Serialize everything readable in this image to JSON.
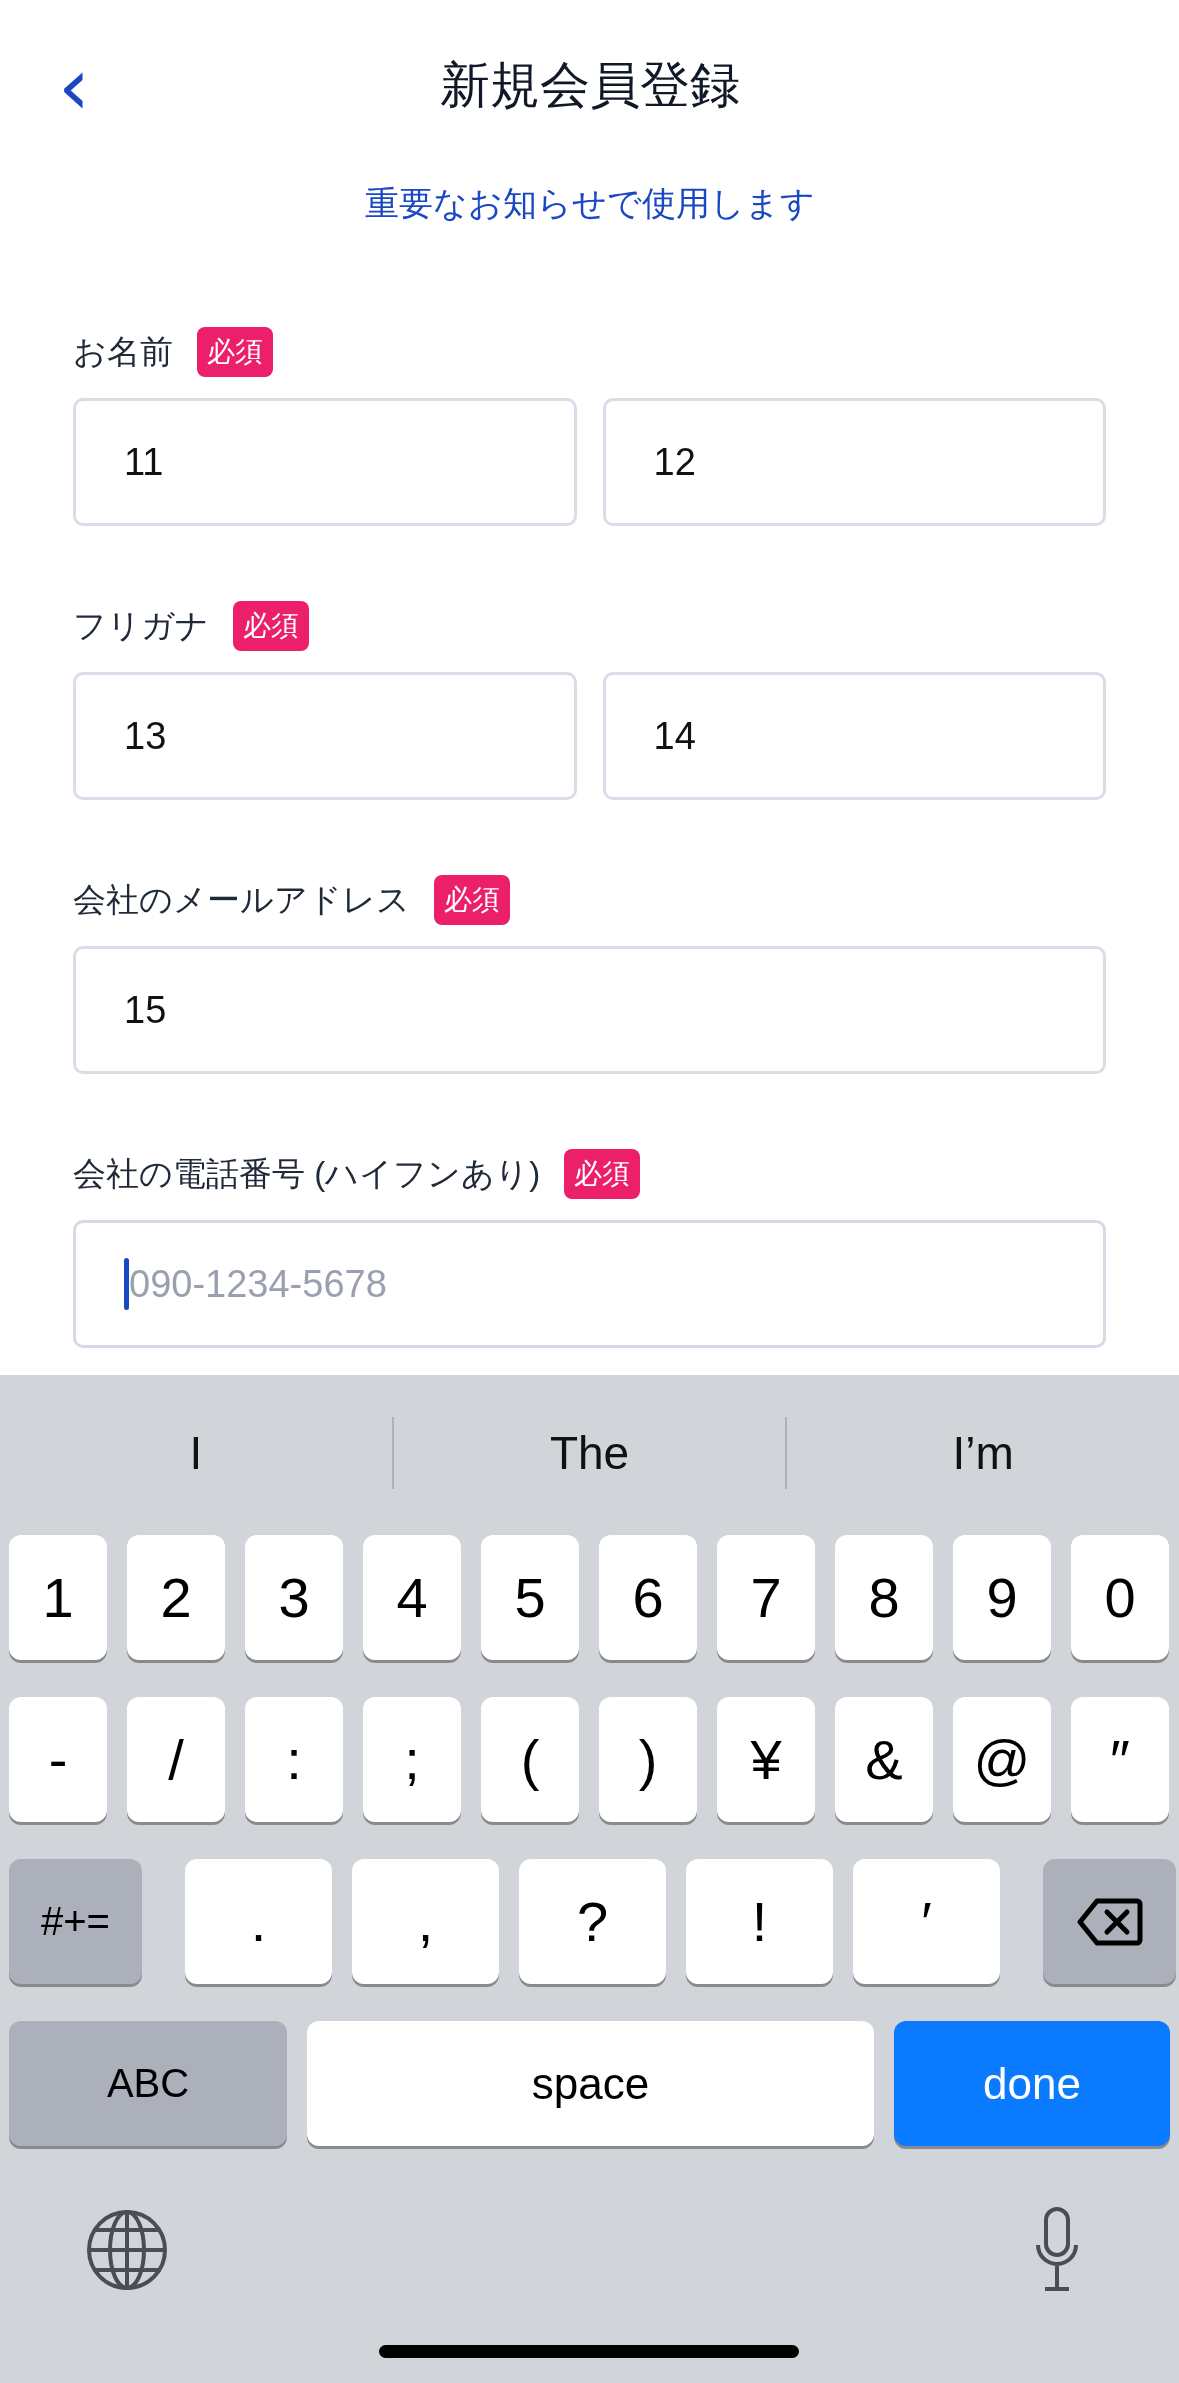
{
  "header": {
    "back": "‹",
    "title": "新規会員登録"
  },
  "notice": "重要なお知らせで使用します",
  "fields": [
    {
      "label": "お名前",
      "badge": "必須",
      "inputs": [
        {
          "value": "11",
          "focused": false
        },
        {
          "value": "12",
          "focused": false
        }
      ]
    },
    {
      "label": "フリガナ",
      "badge": "必須",
      "inputs": [
        {
          "value": "13",
          "focused": false
        },
        {
          "value": "14",
          "focused": false
        }
      ]
    },
    {
      "label": "会社のメールアドレス",
      "badge": "必須",
      "inputs": [
        {
          "value": "15",
          "focused": false
        }
      ]
    },
    {
      "label": "会社の電話番号 (ハイフンあり)",
      "badge": "必須",
      "inputs": [
        {
          "placeholder": "090-1234-5678",
          "focused": true
        }
      ]
    }
  ],
  "keyboard": {
    "suggestions": [
      "I",
      "The",
      "I’m"
    ],
    "number_keys": [
      {
        "kind": "char",
        "label": "1"
      },
      {
        "kind": "char",
        "label": "2"
      },
      {
        "kind": "char",
        "label": "3"
      },
      {
        "kind": "char",
        "label": "4"
      },
      {
        "kind": "char",
        "label": "5"
      },
      {
        "kind": "char",
        "label": "6"
      },
      {
        "kind": "char",
        "label": "7"
      },
      {
        "kind": "char",
        "label": "8"
      },
      {
        "kind": "char",
        "label": "9"
      },
      {
        "kind": "char",
        "label": "0"
      }
    ],
    "symbol_keys": [
      {
        "kind": "char",
        "label": "-"
      },
      {
        "kind": "char",
        "label": "/"
      },
      {
        "kind": "char",
        "label": ":"
      },
      {
        "kind": "char",
        "label": ";"
      },
      {
        "kind": "char",
        "label": "("
      },
      {
        "kind": "char",
        "label": ")"
      },
      {
        "kind": "char",
        "label": "¥"
      },
      {
        "kind": "char",
        "label": "&"
      },
      {
        "kind": "char",
        "label": "@"
      },
      {
        "kind": "char",
        "label": "″"
      }
    ],
    "punctuation_keys": [
      {
        "kind": "function",
        "label": "#+="
      },
      {
        "kind": "wide",
        "label": "."
      },
      {
        "kind": "wide",
        "label": ","
      },
      {
        "kind": "wide",
        "label": "?"
      },
      {
        "kind": "wide",
        "label": "!"
      },
      {
        "kind": "wide",
        "label": "′"
      },
      {
        "kind": "delete"
      }
    ],
    "bottom_keys": [
      {
        "kind": "function",
        "label": "ABC"
      },
      {
        "kind": "space",
        "label": "space"
      },
      {
        "kind": "primary",
        "label": "done"
      }
    ]
  }
}
